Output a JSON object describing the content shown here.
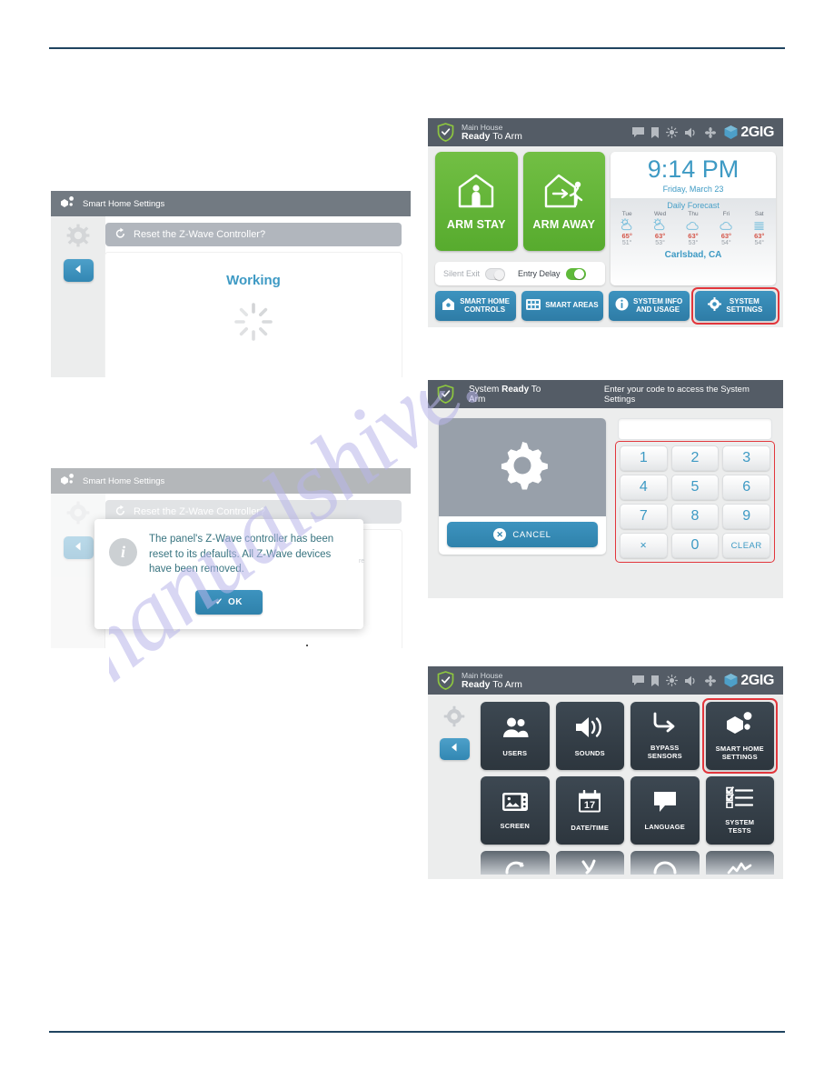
{
  "page": {
    "watermark": "manualshive.com"
  },
  "panel_home": {
    "statusbar": {
      "location": "Main House",
      "state_bold": "Ready",
      "state_rest": " To Arm",
      "icons": [
        "message-icon",
        "bookmark-icon",
        "brightness-icon",
        "speaker-icon",
        "zwave-icon"
      ],
      "logo": "2GIG"
    },
    "arm_stay_label": "ARM STAY",
    "arm_away_label": "ARM AWAY",
    "toggles": [
      {
        "label": "Silent Exit",
        "state": "off"
      },
      {
        "label": "Entry Delay",
        "state": "on"
      }
    ],
    "clock": {
      "time": "9:14 PM",
      "date": "Friday, March 23"
    },
    "forecast": {
      "title": "Daily Forecast",
      "city": "Carlsbad, CA",
      "days": [
        {
          "name": "Tue",
          "icon": "sun-cloud-icon",
          "high": "65°",
          "low": "51°"
        },
        {
          "name": "Wed",
          "icon": "sun-cloud-icon",
          "high": "63°",
          "low": "53°"
        },
        {
          "name": "Thu",
          "icon": "cloud-icon",
          "high": "63°",
          "low": "53°"
        },
        {
          "name": "Fri",
          "icon": "cloud-icon",
          "high": "63°",
          "low": "54°"
        },
        {
          "name": "Sat",
          "icon": "fog-icon",
          "high": "63°",
          "low": "54°"
        }
      ]
    },
    "actions": [
      {
        "line1": "SMART HOME",
        "line2": "CONTROLS",
        "icon": "home-smart-icon",
        "highlighted": false
      },
      {
        "line1": "SMART AREAS",
        "line2": "",
        "icon": "areas-icon",
        "highlighted": false
      },
      {
        "line1": "SYSTEM INFO",
        "line2": "AND USAGE",
        "icon": "info-icon",
        "highlighted": false
      },
      {
        "line1": "SYSTEM",
        "line2": "SETTINGS",
        "icon": "gear-icon",
        "highlighted": true
      }
    ],
    "highlight_color": "#e2363c"
  },
  "panel_keypad": {
    "statusbar": {
      "state_pre": "System ",
      "state_bold": "Ready",
      "state_rest": " To Arm",
      "prompt": "Enter your code to access the System Settings"
    },
    "display_value": "",
    "cancel_label": "CANCEL",
    "keys": [
      "1",
      "2",
      "3",
      "4",
      "5",
      "6",
      "7",
      "8",
      "9",
      "✕",
      "0",
      "CLEAR"
    ],
    "gear_icon": "gear-icon"
  },
  "panel_settings": {
    "statusbar": {
      "location": "Main House",
      "state_bold": "Ready",
      "state_rest": " To Arm",
      "logo": "2GIG"
    },
    "tiles": [
      {
        "label": "USERS",
        "icon": "users-icon",
        "highlighted": false
      },
      {
        "label": "SOUNDS",
        "icon": "speaker-icon",
        "highlighted": false
      },
      {
        "label": "BYPASS\nSENSORS",
        "line1": "BYPASS",
        "line2": "SENSORS",
        "icon": "bypass-arrow-icon",
        "highlighted": false
      },
      {
        "line1": "SMART HOME",
        "line2": "SETTINGS",
        "icon": "smart-home-icon",
        "highlighted": true
      },
      {
        "label": "SCREEN",
        "icon": "screen-icon",
        "highlighted": false
      },
      {
        "label": "DATE/TIME",
        "icon": "calendar-icon",
        "highlighted": false
      },
      {
        "label": "LANGUAGE",
        "icon": "speech-bubble-icon",
        "highlighted": false
      },
      {
        "line1": "SYSTEM",
        "line2": "TESTS",
        "icon": "checklist-icon",
        "highlighted": false
      }
    ],
    "back_icon": "back-arrow-icon",
    "gear_icon": "gear-icon"
  },
  "panel_working": {
    "title": "Smart Home Settings",
    "title_icon": "smart-home-icon",
    "question": "Reset the Z-Wave Controller?",
    "question_icon": "reset-icon",
    "status_text": "Working",
    "spinner_icon": "spinner-icon",
    "back_icon": "back-arrow-icon",
    "gear_icon": "gear-icon"
  },
  "panel_dialog": {
    "title": "Smart Home Settings",
    "title_icon": "smart-home-icon",
    "question": "Reset the Z-Wave Controller?",
    "question_icon": "reset-icon",
    "message": "The panel's Z-Wave controller has been reset to its defaults. All Z-Wave devices have been removed.",
    "info_icon": "info-icon",
    "ok_label": "OK",
    "ok_check": "✓",
    "back_icon": "back-arrow-icon",
    "gear_icon": "gear-icon"
  }
}
